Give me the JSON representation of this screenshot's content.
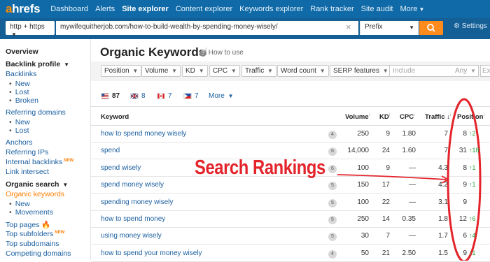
{
  "nav": {
    "logo_a": "a",
    "logo_rest": "hrefs",
    "items": [
      "Dashboard",
      "Alerts",
      "Site explorer",
      "Content explorer",
      "Keywords explorer",
      "Rank tracker",
      "Site audit",
      "More"
    ]
  },
  "urlbar": {
    "mode": "http + https",
    "url": "mywifequitherjob.com/how-to-build-wealth-by-spending-money-wisely/",
    "scope": "Prefix",
    "settings": "Settings"
  },
  "sidebar": {
    "overview": "Overview",
    "backlink_profile": "Backlink profile",
    "backlinks": "Backlinks",
    "backlinks_new": "New",
    "backlinks_lost": "Lost",
    "backlinks_broken": "Broken",
    "referring_domains": "Referring domains",
    "rd_new": "New",
    "rd_lost": "Lost",
    "anchors": "Anchors",
    "referring_ips": "Referring IPs",
    "internal_backlinks": "Internal backlinks",
    "new_badge": "NEW",
    "link_intersect": "Link intersect",
    "organic_search": "Organic search",
    "organic_keywords": "Organic keywords",
    "ok_new": "New",
    "ok_movements": "Movements",
    "top_pages": "Top pages",
    "top_subfolders": "Top subfolders",
    "top_subdomains": "Top subdomains",
    "competing_domains": "Competing domains"
  },
  "page": {
    "title": "Organic Keywords",
    "info_mark": "i",
    "howto": "How to use"
  },
  "filters": {
    "buttons": [
      "Position",
      "Volume",
      "KD",
      "CPC",
      "Traffic",
      "Word count",
      "SERP features"
    ],
    "include_placeholder": "Include",
    "any": "Any",
    "ex": "Ex"
  },
  "countries": {
    "us": "87",
    "uk": "8",
    "ca": "7",
    "ph": "7",
    "more": "More"
  },
  "table": {
    "headers": {
      "keyword": "Keyword",
      "volume": "Volume",
      "kd": "KD",
      "cpc": "CPC",
      "traffic": "Traffic",
      "position": "Position"
    },
    "rows": [
      {
        "keyword": "how to spend money wisely",
        "words": "4",
        "volume": "250",
        "kd": "9",
        "cpc": "1.80",
        "traffic": "7",
        "position": "8",
        "change": "2"
      },
      {
        "keyword": "spend",
        "words": "6",
        "volume": "14,000",
        "kd": "24",
        "cpc": "1.60",
        "traffic": "7",
        "position": "31",
        "change": "18"
      },
      {
        "keyword": "spend wisely",
        "words": "6",
        "volume": "100",
        "kd": "9",
        "cpc": "—",
        "traffic": "4.3",
        "position": "8",
        "change": "1"
      },
      {
        "keyword": "spend money wisely",
        "words": "5",
        "volume": "150",
        "kd": "17",
        "cpc": "—",
        "traffic": "4.2",
        "position": "9",
        "change": "1"
      },
      {
        "keyword": "spending money wisely",
        "words": "5",
        "volume": "100",
        "kd": "22",
        "cpc": "—",
        "traffic": "3.1",
        "position": "9",
        "change": ""
      },
      {
        "keyword": "how to spend money",
        "words": "5",
        "volume": "250",
        "kd": "14",
        "cpc": "0.35",
        "traffic": "1.8",
        "position": "12",
        "change": "6"
      },
      {
        "keyword": "using money wisely",
        "words": "5",
        "volume": "30",
        "kd": "7",
        "cpc": "—",
        "traffic": "1.7",
        "position": "6",
        "change": "4"
      },
      {
        "keyword": "how to spend your money wisely",
        "words": "4",
        "volume": "50",
        "kd": "21",
        "cpc": "2.50",
        "traffic": "1.5",
        "position": "9",
        "change": "1"
      }
    ]
  },
  "annotation": {
    "text": "Search Rankings",
    "color": "#e3242b"
  },
  "colors": {
    "nav_bg": "#0f6aa7",
    "accent_orange": "#ff8b1d",
    "link_blue": "#1b5fa0",
    "up_green": "#2a9d3c"
  }
}
